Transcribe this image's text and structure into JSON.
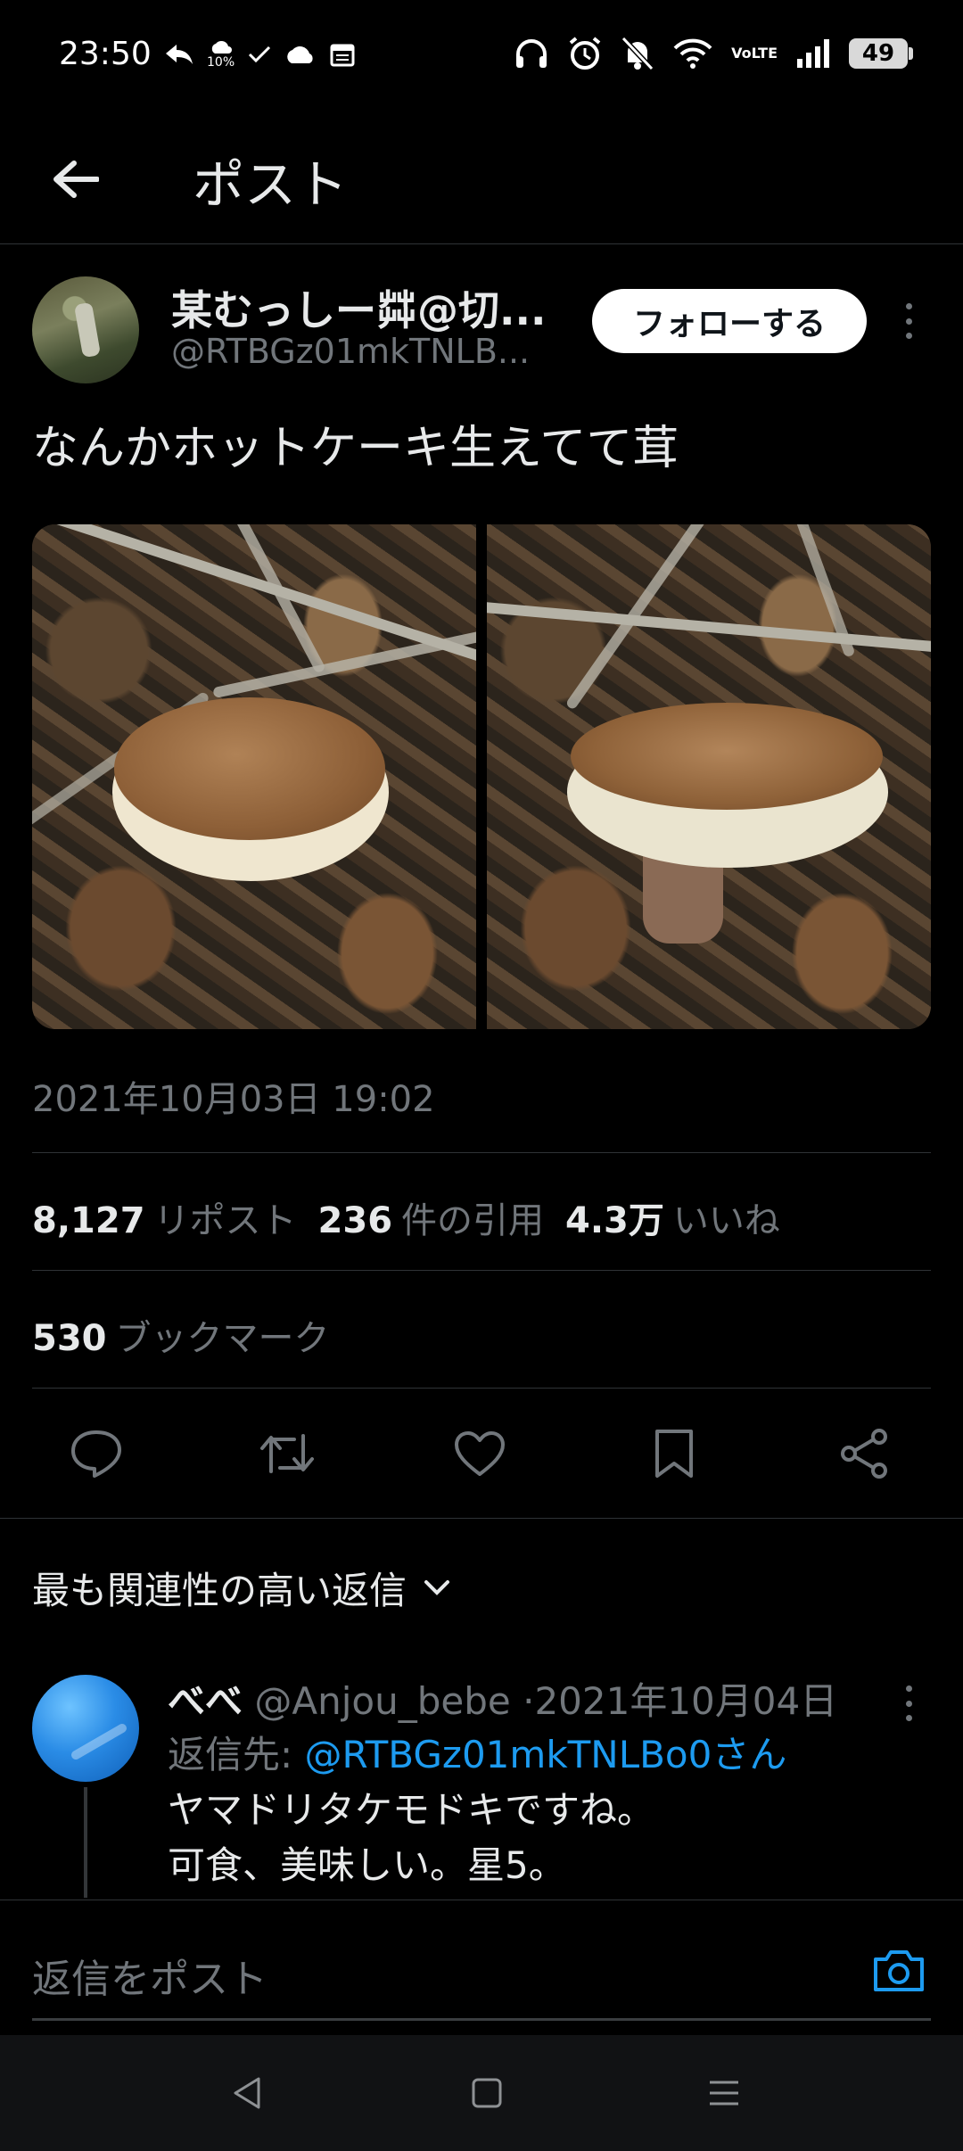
{
  "status_bar": {
    "time": "23:50",
    "rain_pct": "10%",
    "battery": "49",
    "network": "VoLTE",
    "icons_left": [
      "reply-arrow-icon",
      "rain-icon",
      "check-icon",
      "cloud-icon",
      "calendar-icon"
    ],
    "icons_right": [
      "headphones-icon",
      "alarm-icon",
      "bell-off-icon",
      "wifi-icon",
      "volte-icon",
      "signal-icon",
      "battery-icon"
    ]
  },
  "header": {
    "title": "ポスト"
  },
  "author": {
    "name": "某むっしー茻@切...",
    "handle": "@RTBGz01mkTNLB...",
    "follow_label": "フォローする"
  },
  "post": {
    "text": "なんかホットケーキ生えてて茸",
    "timestamp": "2021年10月03日 19:02"
  },
  "stats": {
    "reposts": "8,127",
    "reposts_label": "リポスト",
    "quotes": "236",
    "quotes_label": "件の引用",
    "likes": "4.3万",
    "likes_label": "いいね",
    "bookmarks": "530",
    "bookmarks_label": "ブックマーク"
  },
  "actions": [
    "reply-icon",
    "repost-icon",
    "like-icon",
    "bookmark-icon",
    "share-icon"
  ],
  "replies_sort": {
    "label": "最も関連性の高い返信"
  },
  "reply": {
    "name": "べべ",
    "handle": "@Anjou_bebe",
    "date": "2021年10月04日",
    "reply_to_label": "返信先:",
    "reply_to_handle": "@RTBGz01mkTNLBo0さん",
    "line1": "ヤマドリタケモドキですね。",
    "line2": "可食、美味しい。星5。"
  },
  "composer": {
    "placeholder": "返信をポスト"
  },
  "colors": {
    "accent": "#1d9bf0",
    "background": "#000000",
    "muted": "#71767b",
    "text": "#e7e9ea"
  }
}
